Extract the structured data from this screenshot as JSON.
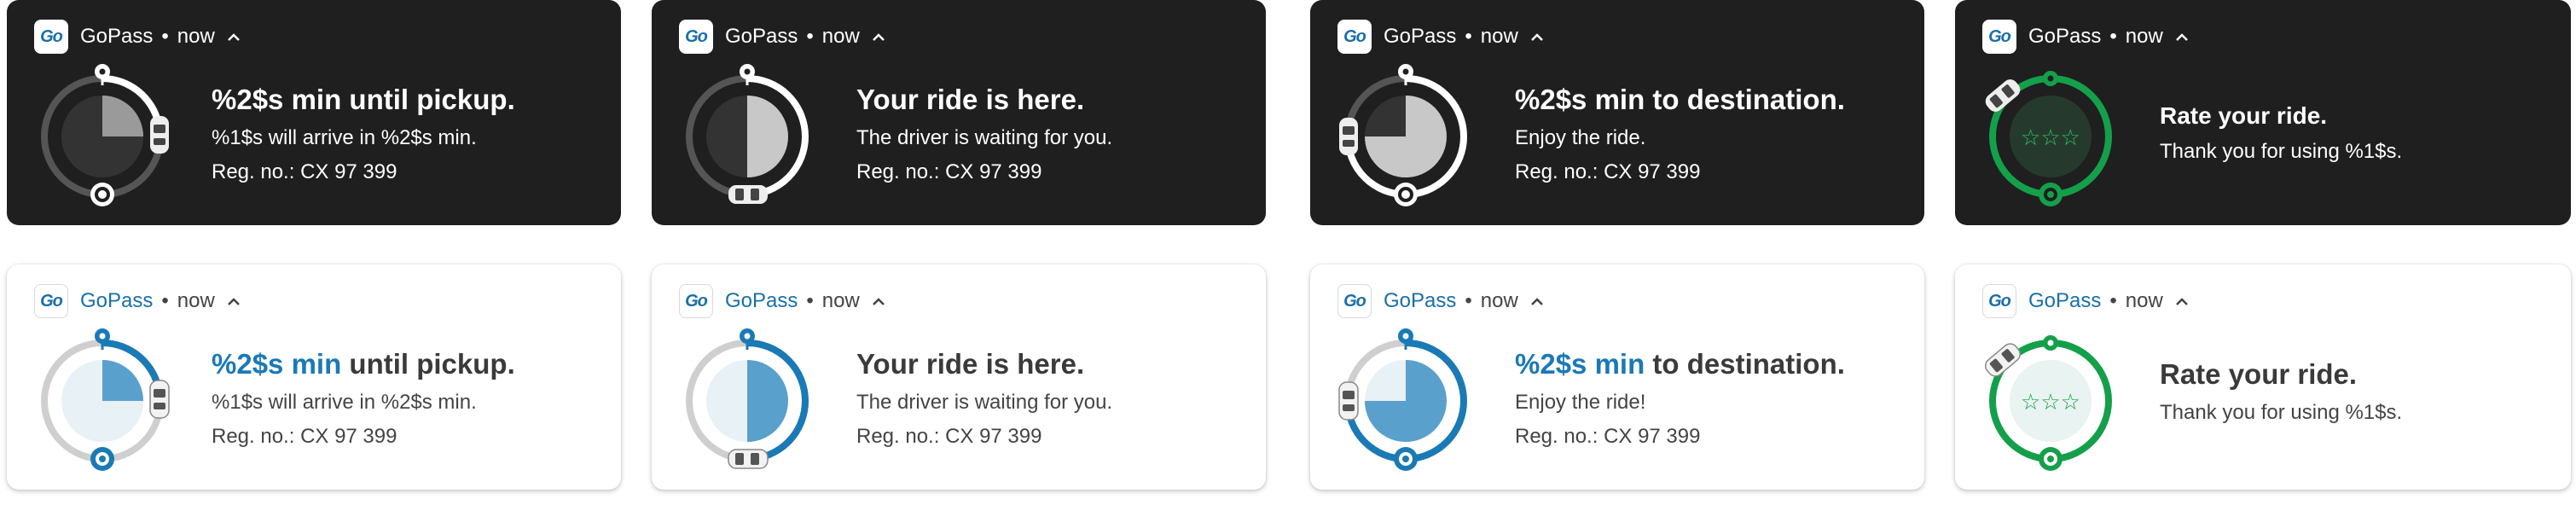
{
  "app": {
    "name": "GoPass",
    "icon_text": "Go",
    "separator": "•",
    "time": "now"
  },
  "colors": {
    "dark_bg": "#1f1f1f",
    "light_bg": "#ffffff",
    "blue": "#1a7ab6",
    "green": "#14a04a"
  },
  "dark": [
    {
      "title": "%2$s min until pickup.",
      "line1": "%1$s will arrive in %2$s min.",
      "line2": "Reg. no.: CX 97 399"
    },
    {
      "title": "Your ride is here.",
      "line1": "The driver is waiting for you.",
      "line2": "Reg. no.: CX 97 399"
    },
    {
      "title": "%2$s min to destination.",
      "line1": "Enjoy the ride.",
      "line2": "Reg. no.: CX 97 399"
    },
    {
      "title": "Rate your ride.",
      "line1": "Thank you for using %1$s.",
      "stars": "☆☆☆"
    }
  ],
  "light": [
    {
      "title_accent": "%2$s min",
      "title_rest": " until pickup.",
      "line1": "%1$s will arrive in %2$s min.",
      "line2": "Reg. no.: CX 97 399"
    },
    {
      "title": "Your ride is here.",
      "line1": "The driver is waiting for you.",
      "line2": "Reg. no.: CX 97 399"
    },
    {
      "title_accent": "%2$s min",
      "title_rest": " to destination.",
      "line1": "Enjoy the ride!",
      "line2": "Reg. no.: CX 97 399"
    },
    {
      "title": "Rate your ride.",
      "line1": "Thank you for using %1$s.",
      "stars": "☆☆☆"
    }
  ]
}
